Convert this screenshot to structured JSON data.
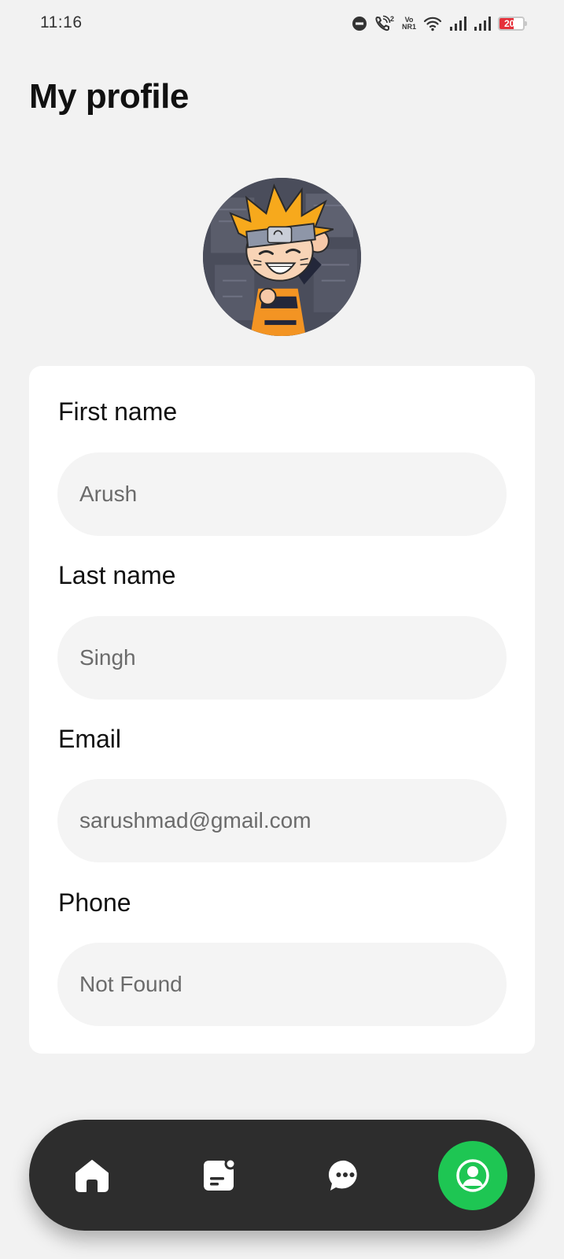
{
  "status_bar": {
    "time": "11:16",
    "call_superscript": "2",
    "net_top": "Vo",
    "net_bottom": "NR1",
    "battery_level": "20",
    "battery_color": "#e5303a",
    "icons": [
      "do-not-disturb-icon",
      "wifi-call-icon",
      "volte-nr-icon",
      "wifi-icon",
      "signal-icon",
      "signal-icon",
      "battery-icon"
    ]
  },
  "header": {
    "title": "My profile"
  },
  "profile": {
    "avatar": "profile-avatar-image"
  },
  "form": {
    "first_name_label": "First name",
    "first_name_value": "Arush",
    "last_name_label": "Last name",
    "last_name_value": "Singh",
    "email_label": "Email",
    "email_value": "sarushmad@gmail.com",
    "phone_label": "Phone",
    "phone_value": "Not Found"
  },
  "nav": {
    "items": [
      {
        "icon": "home-icon",
        "active": false
      },
      {
        "icon": "notes-icon",
        "active": false
      },
      {
        "icon": "chat-icon",
        "active": false
      },
      {
        "icon": "profile-icon",
        "active": true
      }
    ],
    "active_color": "#1ec653",
    "background_color": "#2d2d2d"
  }
}
